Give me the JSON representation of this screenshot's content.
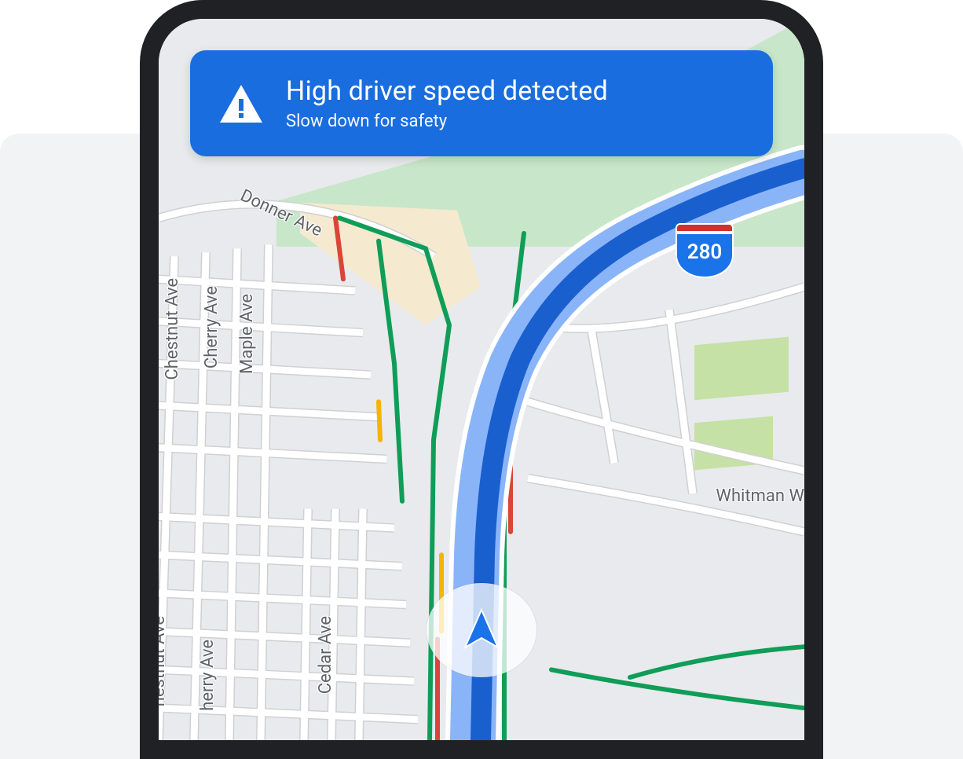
{
  "alert": {
    "title": "High driver speed detected",
    "subtitle": "Slow down for safety"
  },
  "map": {
    "highway_number": "280",
    "streets": {
      "donner": "Donner Ave",
      "chestnut": "Chestnut Ave",
      "cherry": "Cherry Ave",
      "maple": "Maple Ave",
      "whitman": "Whitman W",
      "cedar": "Cedar Ave",
      "chestnut2": "hestnut Ave",
      "cherry2": "herry Ave"
    }
  },
  "colors": {
    "alert_bg": "#1a6dde",
    "route_blue": "#1a73e8",
    "traffic_green": "#0f9d58",
    "traffic_red": "#db4437",
    "traffic_yellow": "#f4b400"
  }
}
